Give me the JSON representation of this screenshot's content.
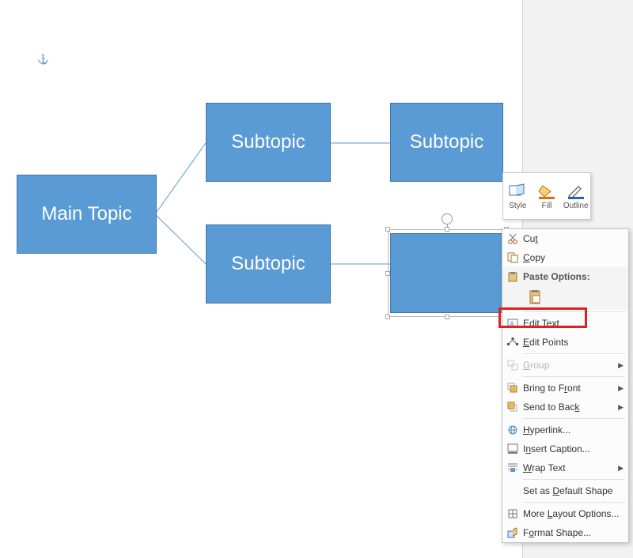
{
  "anchor_glyph": "⚓",
  "boxes": {
    "main": "Main Topic",
    "sub1": "Subtopic",
    "sub2": "Subtopic",
    "sub3": "Subtopic"
  },
  "mini_toolbar": {
    "style": "Style",
    "fill": "Fill",
    "outline": "Outline"
  },
  "context_menu": {
    "cut": "Cut",
    "copy": "Copy",
    "paste_options": "Paste Options:",
    "edit_text": "Edit Text",
    "edit_points": "Edit Points",
    "group": "Group",
    "bring_to_front": "Bring to Front",
    "send_to_back": "Send to Back",
    "hyperlink": "Hyperlink...",
    "insert_caption": "Insert Caption...",
    "wrap_text": "Wrap Text",
    "set_default": "Set as Default Shape",
    "more_layout": "More Layout Options...",
    "format_shape": "Format Shape..."
  }
}
